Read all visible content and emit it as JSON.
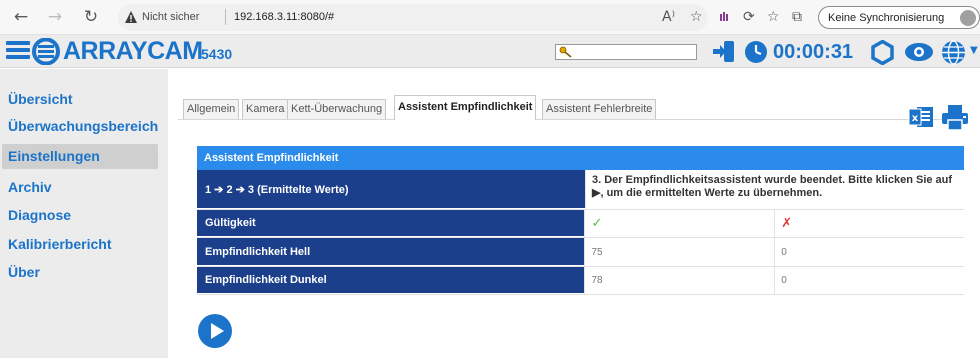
{
  "browser": {
    "security_label": "Nicht sicher",
    "url": "192.168.3.11:8080/#",
    "sync_label": "Keine Synchronisierung"
  },
  "app": {
    "brand": "ARRAYCAM",
    "model": "5430",
    "timer": "00:00:31",
    "accent_color": "#1b74c9"
  },
  "sidebar": {
    "items": [
      {
        "label": "Übersicht",
        "active": false
      },
      {
        "label": "Überwachungsbereich",
        "active": false
      },
      {
        "label": "Einstellungen",
        "active": true
      },
      {
        "label": "Archiv",
        "active": false
      },
      {
        "label": "Diagnose",
        "active": false
      },
      {
        "label": "Kalibrierbericht",
        "active": false
      },
      {
        "label": "Über",
        "active": false
      }
    ]
  },
  "tabs": [
    {
      "label": "Allgemein",
      "active": false
    },
    {
      "label": "Kamera",
      "active": false
    },
    {
      "label": "Kett-Überwachung",
      "active": false
    },
    {
      "label": "Assistent Empfindlichkeit",
      "active": true
    },
    {
      "label": "Assistent Fehlerbreite",
      "active": false
    }
  ],
  "wizard": {
    "title": "Assistent Empfindlichkeit",
    "steps_label": "1 ➔ 2 ➔ 3 (Ermittelte Werte)",
    "message": "3. Der Empfindlichkeitsassistent wurde beendet. Bitte klicken Sie auf ▶, um die ermittelten Werte zu übernehmen.",
    "rows": [
      {
        "label": "Gültigkeit",
        "value_1": "✓",
        "value_2": "✗"
      },
      {
        "label": "Empfindlichkeit Hell",
        "value_1": "75",
        "value_2": "0"
      },
      {
        "label": "Empfindlichkeit Dunkel",
        "value_1": "78",
        "value_2": "0"
      }
    ]
  }
}
